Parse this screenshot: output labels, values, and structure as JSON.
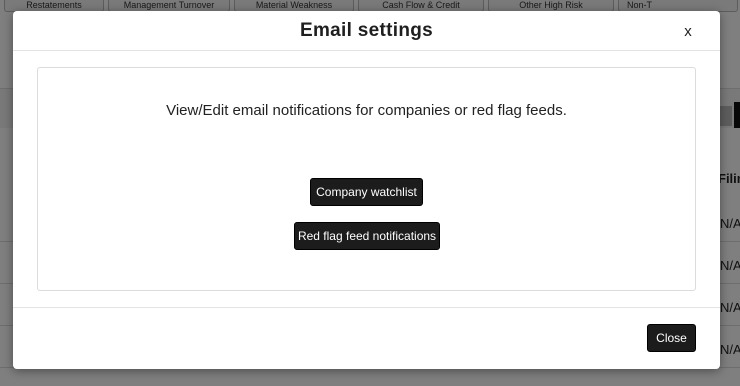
{
  "background": {
    "tabs": [
      "Restatements",
      "Management Turnover",
      "Material Weakness",
      "Cash Flow & Credit",
      "Other High Risk",
      "Non-T"
    ],
    "table_header_right": "Filin",
    "rows_right": [
      "N/A",
      "N/A",
      "N/A",
      "N/A"
    ]
  },
  "modal": {
    "title": "Email settings",
    "close_x": "x",
    "intro": "View/Edit email notifications for companies or red flag feeds.",
    "buttons": {
      "watchlist": "Company watchlist",
      "red_flag": "Red flag feed notifications"
    },
    "footer": {
      "close": "Close"
    }
  }
}
